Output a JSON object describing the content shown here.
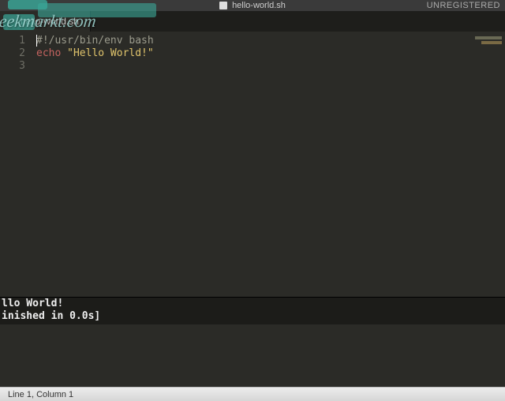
{
  "titlebar": {
    "filename": "hello-world.sh",
    "status": "UNREGISTERED"
  },
  "tabs": [
    {
      "label": "hello-world.sh"
    }
  ],
  "editor": {
    "line_numbers": [
      "1",
      "2",
      "3"
    ],
    "lines": {
      "l1_shebang": "#!/usr/bin/env bash",
      "l2_keyword": "echo",
      "l2_string": " \"Hello World!\"",
      "l3": ""
    }
  },
  "output": {
    "line1": "llo World!",
    "line2": "inished in 0.0s]"
  },
  "statusbar": {
    "position": "Line 1, Column 1"
  },
  "watermark": {
    "text": "geekmarkt.com"
  }
}
